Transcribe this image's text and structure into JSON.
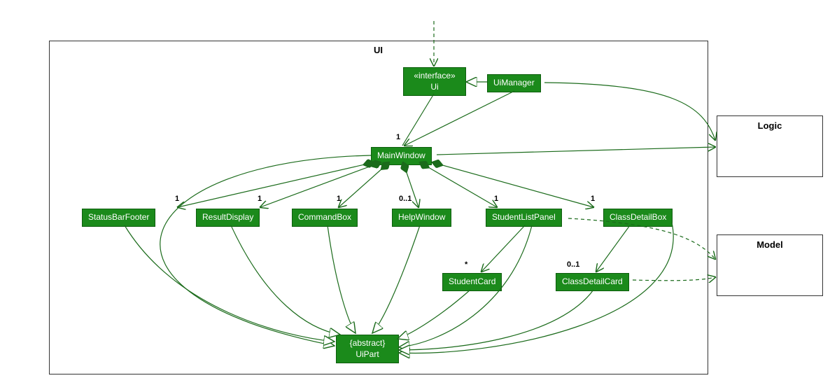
{
  "package": {
    "name": "UI"
  },
  "classes": {
    "ui": {
      "stereotype": "«interface»",
      "name": "Ui"
    },
    "uiManager": {
      "name": "UiManager"
    },
    "mainWindow": {
      "name": "MainWindow"
    },
    "statusBar": {
      "name": "StatusBarFooter"
    },
    "resultDisp": {
      "name": "ResultDisplay"
    },
    "cmdBox": {
      "name": "CommandBox"
    },
    "helpWin": {
      "name": "HelpWindow"
    },
    "stuPanel": {
      "name": "StudentListPanel"
    },
    "clsBox": {
      "name": "ClassDetailBox"
    },
    "stuCard": {
      "name": "StudentCard"
    },
    "clsCard": {
      "name": "ClassDetailCard"
    },
    "uiPart": {
      "stereotype": "{abstract}",
      "name": "UiPart"
    }
  },
  "externals": {
    "logic": {
      "name": "Logic"
    },
    "model": {
      "name": "Model"
    }
  },
  "multiplicities": {
    "mainWindow": "1",
    "statusBar": "1",
    "resultDisp": "1",
    "cmdBox": "1",
    "helpWin": "0..1",
    "stuPanel": "1",
    "clsBox": "1",
    "stuCard": "*",
    "clsCard": "0..1"
  }
}
